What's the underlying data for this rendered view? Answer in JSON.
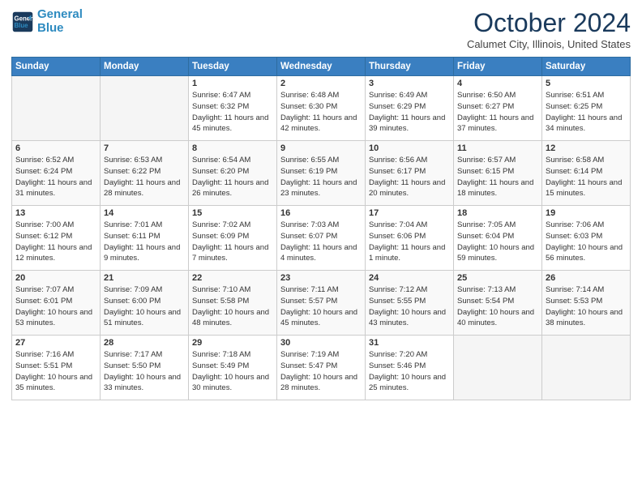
{
  "header": {
    "logo_line1": "General",
    "logo_line2": "Blue",
    "month": "October 2024",
    "location": "Calumet City, Illinois, United States"
  },
  "weekdays": [
    "Sunday",
    "Monday",
    "Tuesday",
    "Wednesday",
    "Thursday",
    "Friday",
    "Saturday"
  ],
  "weeks": [
    [
      {
        "day": "",
        "empty": true
      },
      {
        "day": "",
        "empty": true
      },
      {
        "day": "1",
        "sunrise": "Sunrise: 6:47 AM",
        "sunset": "Sunset: 6:32 PM",
        "daylight": "Daylight: 11 hours and 45 minutes."
      },
      {
        "day": "2",
        "sunrise": "Sunrise: 6:48 AM",
        "sunset": "Sunset: 6:30 PM",
        "daylight": "Daylight: 11 hours and 42 minutes."
      },
      {
        "day": "3",
        "sunrise": "Sunrise: 6:49 AM",
        "sunset": "Sunset: 6:29 PM",
        "daylight": "Daylight: 11 hours and 39 minutes."
      },
      {
        "day": "4",
        "sunrise": "Sunrise: 6:50 AM",
        "sunset": "Sunset: 6:27 PM",
        "daylight": "Daylight: 11 hours and 37 minutes."
      },
      {
        "day": "5",
        "sunrise": "Sunrise: 6:51 AM",
        "sunset": "Sunset: 6:25 PM",
        "daylight": "Daylight: 11 hours and 34 minutes."
      }
    ],
    [
      {
        "day": "6",
        "sunrise": "Sunrise: 6:52 AM",
        "sunset": "Sunset: 6:24 PM",
        "daylight": "Daylight: 11 hours and 31 minutes."
      },
      {
        "day": "7",
        "sunrise": "Sunrise: 6:53 AM",
        "sunset": "Sunset: 6:22 PM",
        "daylight": "Daylight: 11 hours and 28 minutes."
      },
      {
        "day": "8",
        "sunrise": "Sunrise: 6:54 AM",
        "sunset": "Sunset: 6:20 PM",
        "daylight": "Daylight: 11 hours and 26 minutes."
      },
      {
        "day": "9",
        "sunrise": "Sunrise: 6:55 AM",
        "sunset": "Sunset: 6:19 PM",
        "daylight": "Daylight: 11 hours and 23 minutes."
      },
      {
        "day": "10",
        "sunrise": "Sunrise: 6:56 AM",
        "sunset": "Sunset: 6:17 PM",
        "daylight": "Daylight: 11 hours and 20 minutes."
      },
      {
        "day": "11",
        "sunrise": "Sunrise: 6:57 AM",
        "sunset": "Sunset: 6:15 PM",
        "daylight": "Daylight: 11 hours and 18 minutes."
      },
      {
        "day": "12",
        "sunrise": "Sunrise: 6:58 AM",
        "sunset": "Sunset: 6:14 PM",
        "daylight": "Daylight: 11 hours and 15 minutes."
      }
    ],
    [
      {
        "day": "13",
        "sunrise": "Sunrise: 7:00 AM",
        "sunset": "Sunset: 6:12 PM",
        "daylight": "Daylight: 11 hours and 12 minutes."
      },
      {
        "day": "14",
        "sunrise": "Sunrise: 7:01 AM",
        "sunset": "Sunset: 6:11 PM",
        "daylight": "Daylight: 11 hours and 9 minutes."
      },
      {
        "day": "15",
        "sunrise": "Sunrise: 7:02 AM",
        "sunset": "Sunset: 6:09 PM",
        "daylight": "Daylight: 11 hours and 7 minutes."
      },
      {
        "day": "16",
        "sunrise": "Sunrise: 7:03 AM",
        "sunset": "Sunset: 6:07 PM",
        "daylight": "Daylight: 11 hours and 4 minutes."
      },
      {
        "day": "17",
        "sunrise": "Sunrise: 7:04 AM",
        "sunset": "Sunset: 6:06 PM",
        "daylight": "Daylight: 11 hours and 1 minute."
      },
      {
        "day": "18",
        "sunrise": "Sunrise: 7:05 AM",
        "sunset": "Sunset: 6:04 PM",
        "daylight": "Daylight: 10 hours and 59 minutes."
      },
      {
        "day": "19",
        "sunrise": "Sunrise: 7:06 AM",
        "sunset": "Sunset: 6:03 PM",
        "daylight": "Daylight: 10 hours and 56 minutes."
      }
    ],
    [
      {
        "day": "20",
        "sunrise": "Sunrise: 7:07 AM",
        "sunset": "Sunset: 6:01 PM",
        "daylight": "Daylight: 10 hours and 53 minutes."
      },
      {
        "day": "21",
        "sunrise": "Sunrise: 7:09 AM",
        "sunset": "Sunset: 6:00 PM",
        "daylight": "Daylight: 10 hours and 51 minutes."
      },
      {
        "day": "22",
        "sunrise": "Sunrise: 7:10 AM",
        "sunset": "Sunset: 5:58 PM",
        "daylight": "Daylight: 10 hours and 48 minutes."
      },
      {
        "day": "23",
        "sunrise": "Sunrise: 7:11 AM",
        "sunset": "Sunset: 5:57 PM",
        "daylight": "Daylight: 10 hours and 45 minutes."
      },
      {
        "day": "24",
        "sunrise": "Sunrise: 7:12 AM",
        "sunset": "Sunset: 5:55 PM",
        "daylight": "Daylight: 10 hours and 43 minutes."
      },
      {
        "day": "25",
        "sunrise": "Sunrise: 7:13 AM",
        "sunset": "Sunset: 5:54 PM",
        "daylight": "Daylight: 10 hours and 40 minutes."
      },
      {
        "day": "26",
        "sunrise": "Sunrise: 7:14 AM",
        "sunset": "Sunset: 5:53 PM",
        "daylight": "Daylight: 10 hours and 38 minutes."
      }
    ],
    [
      {
        "day": "27",
        "sunrise": "Sunrise: 7:16 AM",
        "sunset": "Sunset: 5:51 PM",
        "daylight": "Daylight: 10 hours and 35 minutes."
      },
      {
        "day": "28",
        "sunrise": "Sunrise: 7:17 AM",
        "sunset": "Sunset: 5:50 PM",
        "daylight": "Daylight: 10 hours and 33 minutes."
      },
      {
        "day": "29",
        "sunrise": "Sunrise: 7:18 AM",
        "sunset": "Sunset: 5:49 PM",
        "daylight": "Daylight: 10 hours and 30 minutes."
      },
      {
        "day": "30",
        "sunrise": "Sunrise: 7:19 AM",
        "sunset": "Sunset: 5:47 PM",
        "daylight": "Daylight: 10 hours and 28 minutes."
      },
      {
        "day": "31",
        "sunrise": "Sunrise: 7:20 AM",
        "sunset": "Sunset: 5:46 PM",
        "daylight": "Daylight: 10 hours and 25 minutes."
      },
      {
        "day": "",
        "empty": true
      },
      {
        "day": "",
        "empty": true
      }
    ]
  ]
}
